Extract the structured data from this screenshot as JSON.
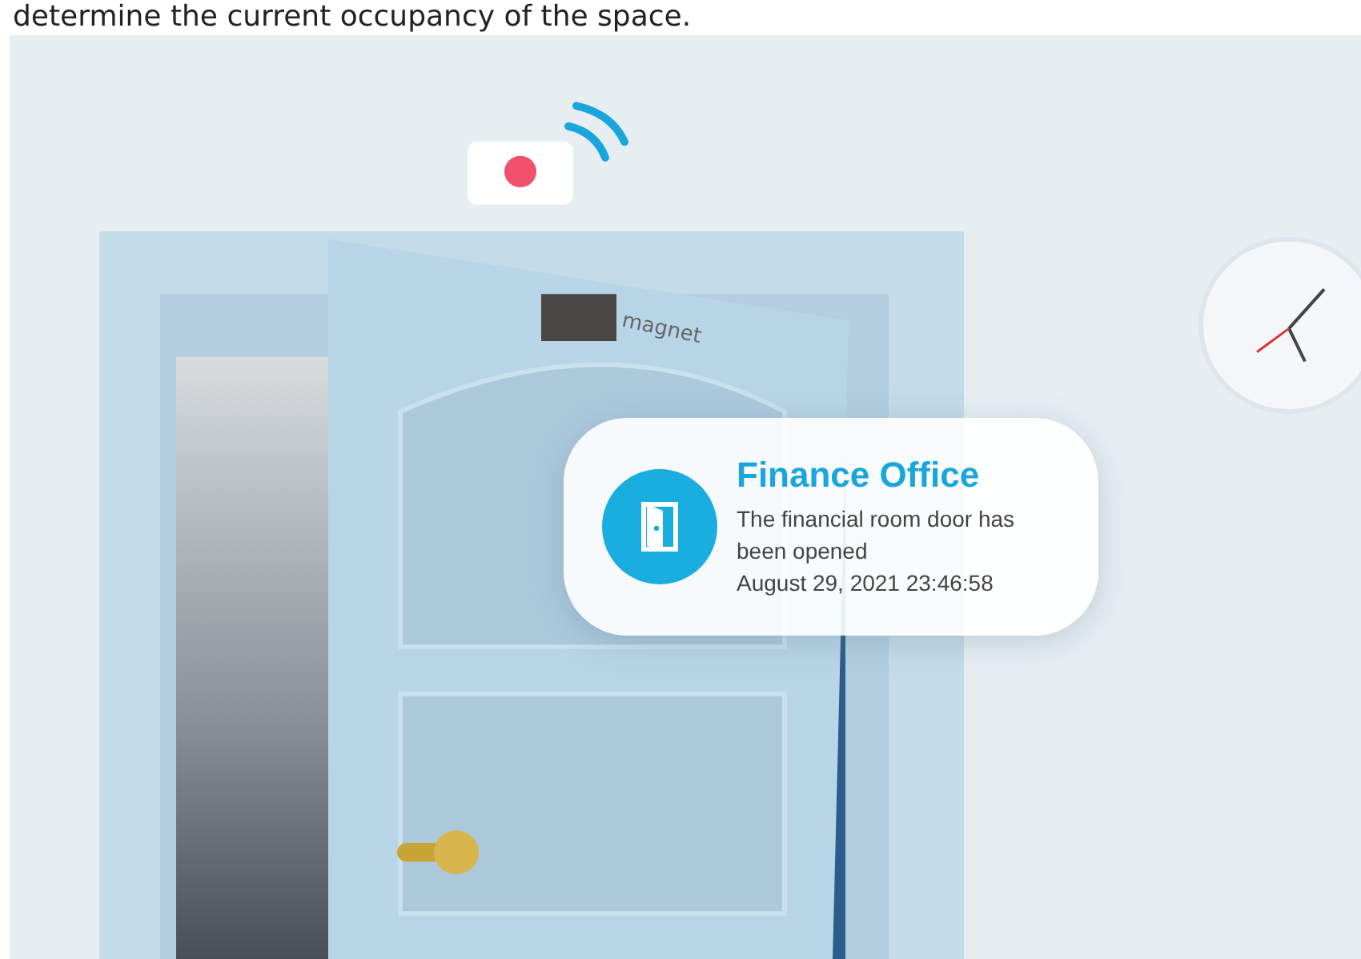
{
  "intro_text": "determine the current occupancy of the space.",
  "illustration": {
    "magnet_label": "magnet",
    "notification": {
      "title": "Finance Office",
      "message": "The financial room door has been opened",
      "timestamp": "August 29, 2021 23:46:58"
    }
  }
}
